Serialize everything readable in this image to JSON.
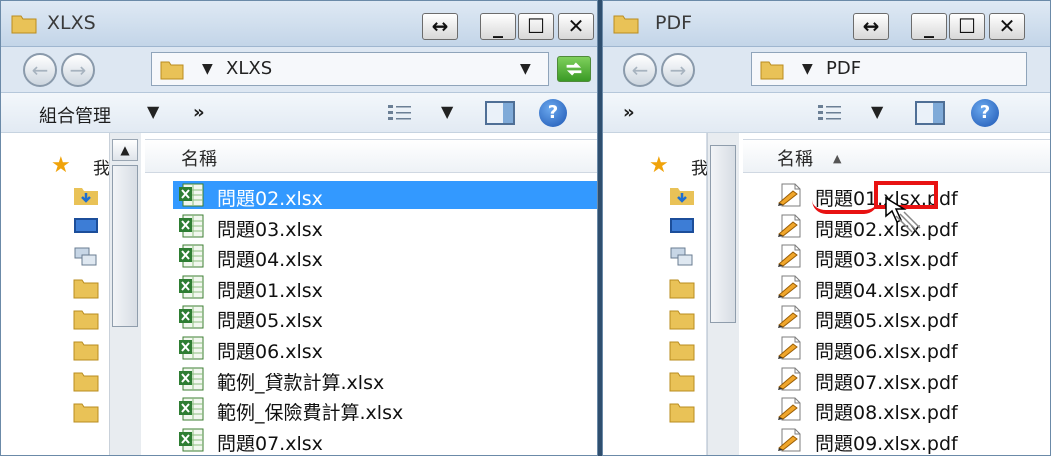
{
  "left_window": {
    "title": "XLXS",
    "address": "XLXS",
    "toolbar": {
      "organize_label": "組合管理",
      "more_label": "»"
    },
    "column_header": "名稱",
    "nav_favorites_label": "我",
    "files": [
      "問題02.xlsx",
      "問題03.xlsx",
      "問題04.xlsx",
      "問題01.xlsx",
      "問題05.xlsx",
      "問題06.xlsx",
      "範例_貸款計算.xlsx",
      "範例_保險費計算.xlsx",
      "問題07.xlsx"
    ],
    "selected_index": 0
  },
  "right_window": {
    "title": "PDF",
    "address": "PDF",
    "toolbar": {
      "more_label": "»"
    },
    "column_header": "名稱",
    "nav_favorites_label": "我",
    "files": [
      "問題01.xlsx.pdf",
      "問題02.xlsx.pdf",
      "問題03.xlsx.pdf",
      "問題04.xlsx.pdf",
      "問題05.xlsx.pdf",
      "問題06.xlsx.pdf",
      "問題07.xlsx.pdf",
      "問題08.xlsx.pdf",
      "問題09.xlsx.pdf"
    ]
  },
  "icons": {
    "folder": "folder-icon",
    "excel": "excel-file-icon",
    "pdf": "pdf-file-icon",
    "back": "back-arrow-icon",
    "forward": "forward-arrow-icon",
    "help": "help-icon",
    "favorites": "star-icon"
  },
  "colors": {
    "selection": "#3399ff",
    "annotation": "#e81212",
    "titlebar": "#c3d5e8"
  }
}
